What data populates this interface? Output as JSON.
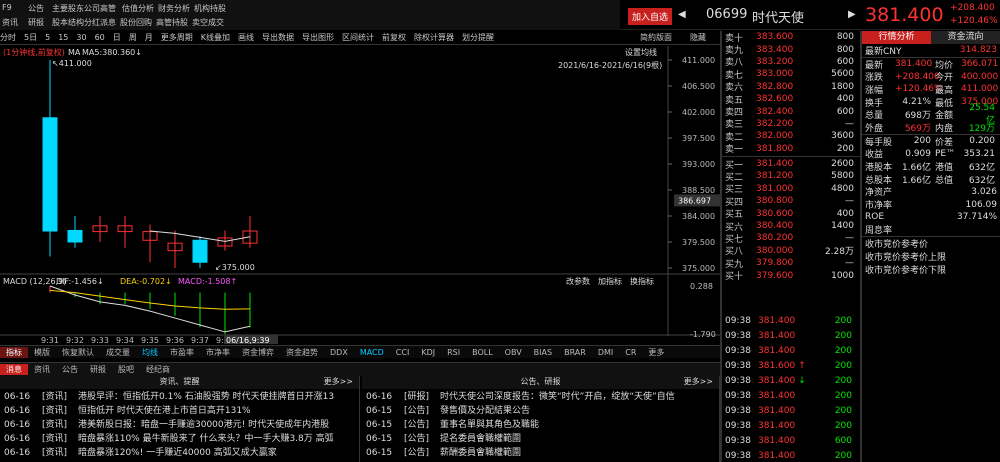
{
  "menu": {
    "row1": [
      "F9",
      "公告",
      "主要股东",
      "公司高管",
      "估值分析",
      "财务分析",
      "机构持股"
    ],
    "row2": [
      "资讯",
      "研报",
      "股本结构",
      "分红派息",
      "股份回购",
      "高管持股",
      "卖空成交"
    ]
  },
  "header": {
    "add_label": "加入自选",
    "code": "06699",
    "name": "时代天使",
    "price": "381.400",
    "change": "+208.400",
    "pct": "+120.46%"
  },
  "toolbar": [
    "分时",
    "5日",
    "5",
    "15",
    "30",
    "60",
    "日",
    "周",
    "月",
    "更多周期",
    "K线叠加",
    "画线",
    "导出数据",
    "导出图形",
    "区间统计",
    "前复权",
    "除权计算器",
    "划分提醒"
  ],
  "toolbar_right": [
    "简約版面",
    "隐藏"
  ],
  "chart_sub": {
    "period": "(1分钟线,前复权)",
    "ma": "MA",
    "ma5": "MA5:380.360↓",
    "set_ma": "设置均线",
    "range": "2021/6/16-2021/6/16(9根)"
  },
  "chart_data": {
    "type": "candlestick",
    "x": [
      "9:31",
      "9:32",
      "9:33",
      "9:34",
      "9:35",
      "9:36",
      "9:37",
      "9:38",
      "9:39"
    ],
    "open": [
      401.0,
      381.5,
      381.3,
      381.3,
      379.8,
      378.0,
      379.8,
      378.8,
      379.3
    ],
    "high": [
      411.0,
      384.0,
      384.0,
      384.0,
      382.5,
      381.5,
      380.5,
      381.5,
      384.0
    ],
    "low": [
      377.0,
      378.5,
      379.5,
      378.5,
      376.0,
      375.0,
      375.0,
      378.0,
      378.5
    ],
    "close": [
      381.4,
      379.5,
      382.3,
      382.3,
      381.3,
      379.3,
      376.0,
      380.2,
      381.4
    ],
    "ma5": [
      null,
      null,
      null,
      null,
      381.4,
      381.0,
      380.3,
      379.6,
      380.4
    ],
    "yticks": [
      "411.000",
      "406.500",
      "402.000",
      "397.500",
      "393.000",
      "388.500",
      "384.000",
      "379.500",
      "375.000"
    ],
    "ylim": [
      375,
      411
    ],
    "hi_label": "411.000",
    "lo_label": "375.000",
    "cur_label": "386.697",
    "xlabels": [
      "9:31",
      "9:32",
      "9:33",
      "9:34",
      "9:35",
      "9:36",
      "9:37",
      "9:38"
    ],
    "xcur": "06/16,9:39",
    "macd": {
      "label": "MACD (12,26,9)",
      "dif": "DIF:-1.456↓",
      "dea": "DEA:-0.702↓",
      "macd": "MACD:-1.508↑",
      "yticks": [
        "0.288",
        "-1.790"
      ],
      "dif_vals": [
        0.288,
        -0.1,
        -0.4,
        -0.55,
        -0.8,
        -1.1,
        -1.4,
        -1.7,
        -1.456
      ],
      "dea_vals": [
        0.1,
        0.0,
        -0.15,
        -0.3,
        -0.45,
        -0.58,
        -0.66,
        -0.72,
        -0.702
      ],
      "bars": [
        0.3,
        -0.2,
        -0.5,
        -0.5,
        -0.7,
        -1.0,
        -1.5,
        -1.8,
        -1.508
      ]
    },
    "macd_tools": [
      "改参数",
      "加指标",
      "换指标"
    ]
  },
  "ind_tabs": [
    "指标",
    "模版",
    "恢复默认",
    "成交量",
    "均线",
    "市盈率",
    "市净率",
    "资金博弈",
    "资金趋势",
    "DDX",
    "MACD",
    "CCI",
    "KDJ",
    "RSI",
    "BOLL",
    "OBV",
    "BIAS",
    "BRAR",
    "DMI",
    "CR",
    "更多"
  ],
  "news_tabs": [
    "消息",
    "资讯",
    "公告",
    "研报",
    "股吧",
    "经纪商"
  ],
  "news_left": {
    "title": "资讯、提醒",
    "more": "更多>>",
    "items": [
      {
        "d": "06-16",
        "t": "[资讯]",
        "s": "港股早评：恒指低开0.1% 石油股强势 时代天使挂牌首日开涨13"
      },
      {
        "d": "06-16",
        "t": "[资讯]",
        "s": "恒指低开 时代天使在港上市首日高开131%"
      },
      {
        "d": "06-16",
        "t": "[资讯]",
        "s": "港美新股日报：暗盘一手赚逾30000港元! 时代天使成年内港股"
      },
      {
        "d": "06-16",
        "t": "[资讯]",
        "s": "暗盘暴涨110% 最牛新股来了 什么来头？中一手大赚3.8万 高弧"
      },
      {
        "d": "06-16",
        "t": "[资讯]",
        "s": "暗盘暴涨120%! 一手赚近40000 高弧又成大赢家"
      }
    ]
  },
  "news_right": {
    "title": "公告、研报",
    "more": "更多>>",
    "items": [
      {
        "d": "06-16",
        "t": "[研报]",
        "s": "时代天使公司深度报告：微笑“时代”开启，绽放“天使”自信"
      },
      {
        "d": "06-15",
        "t": "[公告]",
        "s": "發售價及分配結果公告"
      },
      {
        "d": "06-15",
        "t": "[公告]",
        "s": "董事名單與其角色及職能"
      },
      {
        "d": "06-15",
        "t": "[公告]",
        "s": "提名委員會職權範圍"
      },
      {
        "d": "06-15",
        "t": "[公告]",
        "s": "薪酬委員會職權範圍"
      }
    ]
  },
  "book": {
    "asks": [
      [
        "卖十",
        "383.600",
        "800"
      ],
      [
        "卖九",
        "383.400",
        "800"
      ],
      [
        "卖八",
        "383.200",
        "600"
      ],
      [
        "卖七",
        "383.000",
        "5600"
      ],
      [
        "卖六",
        "382.800",
        "1800"
      ],
      [
        "卖五",
        "382.600",
        "400"
      ],
      [
        "卖四",
        "382.400",
        "600"
      ],
      [
        "卖三",
        "382.200",
        "—"
      ],
      [
        "卖二",
        "382.000",
        "3600"
      ],
      [
        "卖一",
        "381.800",
        "200"
      ]
    ],
    "bids": [
      [
        "买一",
        "381.400",
        "2600"
      ],
      [
        "买二",
        "381.200",
        "5800"
      ],
      [
        "买三",
        "381.000",
        "4800"
      ],
      [
        "买四",
        "380.800",
        "—"
      ],
      [
        "买五",
        "380.600",
        "400"
      ],
      [
        "买六",
        "380.400",
        "1400"
      ],
      [
        "买七",
        "380.200",
        "—"
      ],
      [
        "买八",
        "380.000",
        "2.28万"
      ],
      [
        "买九",
        "379.800",
        "—"
      ],
      [
        "买十",
        "379.600",
        "1000"
      ]
    ]
  },
  "trades": [
    [
      "09:38",
      "381.400",
      "",
      "200",
      "dn"
    ],
    [
      "09:38",
      "381.400",
      "",
      "200",
      "dn"
    ],
    [
      "09:38",
      "381.400",
      "",
      "200",
      "dn"
    ],
    [
      "09:38",
      "381.600",
      "↑",
      "200",
      "dn"
    ],
    [
      "09:38",
      "381.400",
      "↓",
      "200",
      "dn"
    ],
    [
      "09:38",
      "381.400",
      "",
      "200",
      "dn"
    ],
    [
      "09:38",
      "381.400",
      "",
      "200",
      "dn"
    ],
    [
      "09:38",
      "381.400",
      "",
      "200",
      "dn"
    ],
    [
      "09:38",
      "381.400",
      "",
      "600",
      "dn"
    ],
    [
      "09:38",
      "381.400",
      "",
      "200",
      "dn"
    ]
  ],
  "rpanel": {
    "tabs": [
      "行情分析",
      "资金流向"
    ],
    "cny_label": "最新CNY",
    "cny": "314.823",
    "rows": [
      [
        "最新",
        "381.400",
        "up",
        "均价",
        "366.071",
        "up"
      ],
      [
        "涨跌",
        "+208.400",
        "up",
        "今开",
        "400.000",
        "up"
      ],
      [
        "涨幅",
        "+120.46%",
        "up",
        "最高",
        "411.000",
        "up"
      ],
      [
        "换手",
        "4.21%",
        "wh",
        "最低",
        "375.000",
        "up"
      ],
      [
        "总量",
        "698万",
        "wh",
        "金额",
        "25.54亿",
        "dn"
      ],
      [
        "外盘",
        "569万",
        "up",
        "内盘",
        "129万",
        "dn"
      ]
    ],
    "rows2": [
      [
        "每手股",
        "200",
        "wh",
        "价差",
        "0.200",
        "wh"
      ],
      [
        "收益",
        "0.909",
        "wh",
        "PE™",
        "353.21",
        "wh"
      ],
      [
        "港股本",
        "1.66亿",
        "wh",
        "港值",
        "632亿",
        "wh"
      ],
      [
        "总股本",
        "1.66亿",
        "wh",
        "总值",
        "632亿",
        "wh"
      ]
    ],
    "single": [
      [
        "净资产",
        "3.026"
      ],
      [
        "市净率",
        "106.09"
      ],
      [
        "ROE",
        "37.714%"
      ],
      [
        "周息率",
        ""
      ]
    ],
    "extra": [
      "收市竞价参考价",
      "收市竞价参考价上限",
      "收市竞价参考价下限"
    ]
  },
  "colors": {
    "up": "#ff3232",
    "down": "#00e600",
    "cyan": "#00d8ff",
    "accent": "#c8201c"
  }
}
